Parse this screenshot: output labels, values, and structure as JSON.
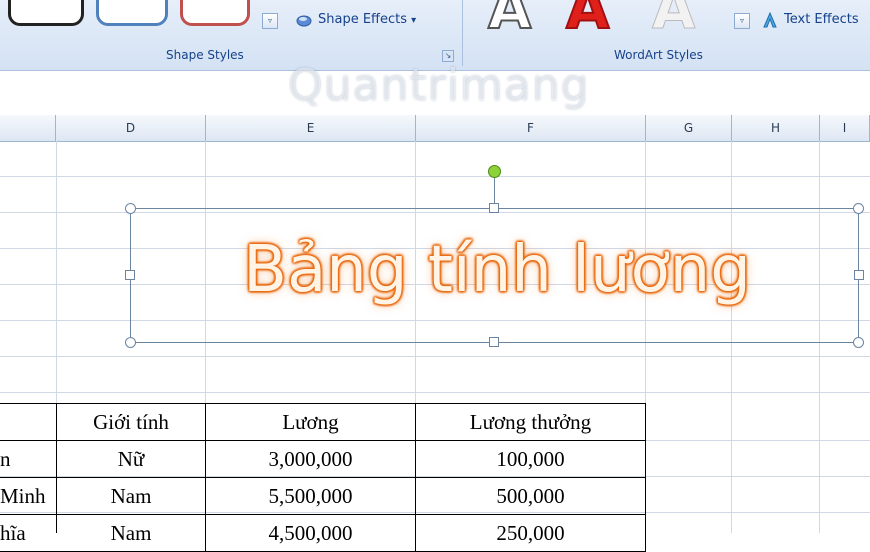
{
  "ribbon": {
    "shape_effects_label": "Shape Effects",
    "text_effects_label": "Text Effects",
    "shape_styles_group": "Shape Styles",
    "wordart_styles_group": "WordArt Styles",
    "dropdown_arrow": "▾",
    "more_arrow": "▿"
  },
  "watermark": "Quantrimang",
  "columns": [
    "D",
    "E",
    "F",
    "G",
    "H",
    "I"
  ],
  "wordart_text": "Bảng tính lương",
  "table": {
    "headers": [
      "",
      "Giới tính",
      "Lương",
      "Lương thưởng"
    ],
    "rows": [
      [
        "n",
        "Nữ",
        "3,000,000",
        "100,000"
      ],
      [
        "Minh",
        "Nam",
        "5,500,000",
        "500,000"
      ],
      [
        "hĩa",
        "Nam",
        "4,500,000",
        "250,000"
      ]
    ]
  },
  "colors": {
    "ribbon_bg": "#dbe6f5",
    "group_label": "#15428b",
    "wordart_outline": "#e9690e",
    "gridline": "#d0d7e5"
  }
}
